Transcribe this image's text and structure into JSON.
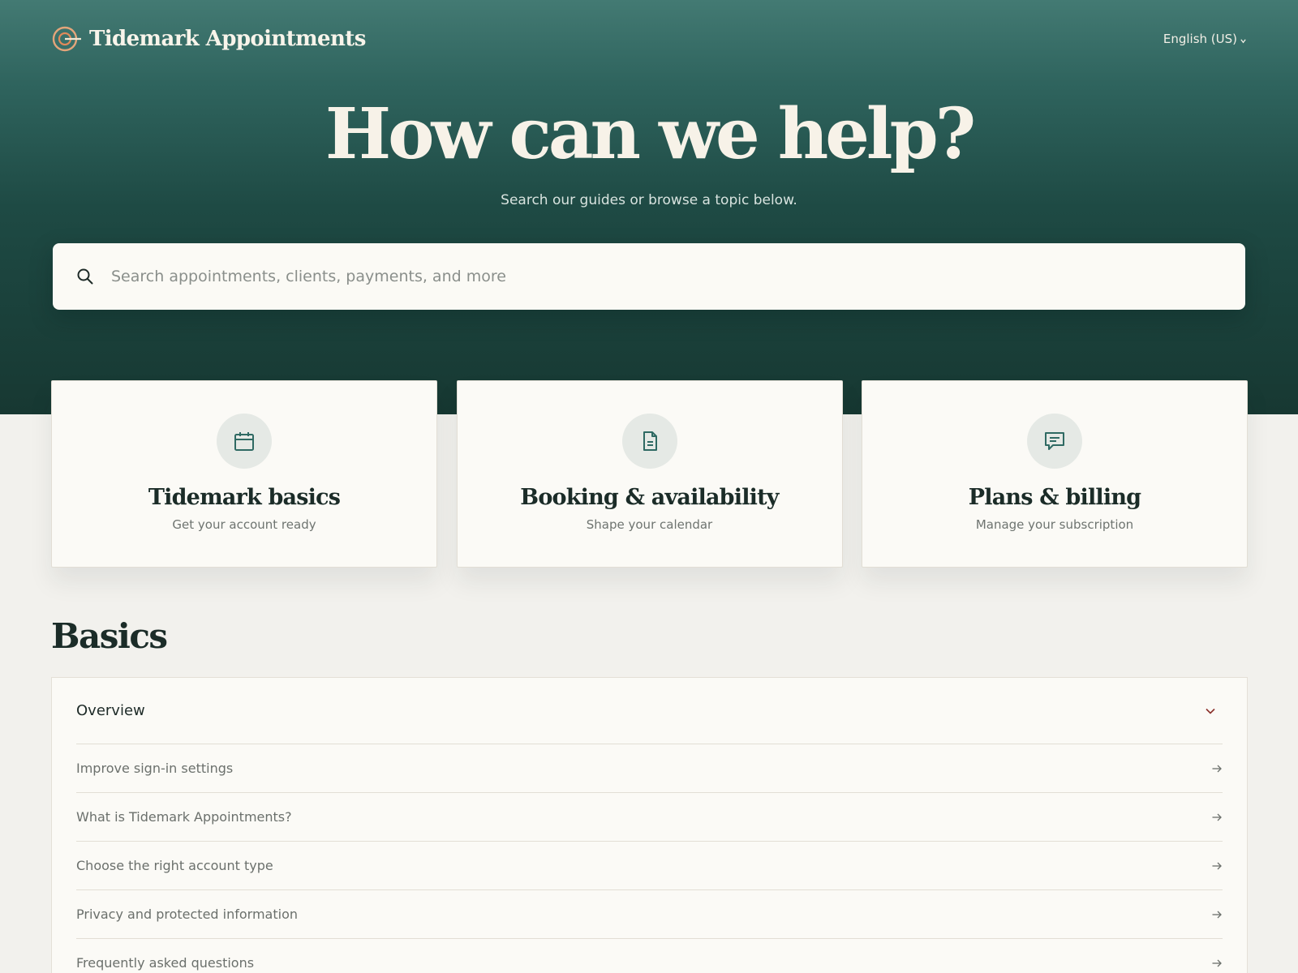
{
  "header": {
    "brand_name": "Tidemark Appointments",
    "language": "English (US)"
  },
  "hero": {
    "title": "How can we help?",
    "subtitle": "Search our guides or browse a topic below."
  },
  "search": {
    "placeholder": "Search appointments, clients, payments, and more",
    "value": ""
  },
  "topics": [
    {
      "title": "Tidemark basics",
      "description": "Get your account ready",
      "icon": "calendar-icon"
    },
    {
      "title": "Booking & availability",
      "description": "Shape your calendar",
      "icon": "document-icon"
    },
    {
      "title": "Plans & billing",
      "description": "Manage your subscription",
      "icon": "chat-icon"
    }
  ],
  "section": {
    "title": "Basics",
    "group_label": "Overview",
    "articles": [
      "Improve sign-in settings",
      "What is Tidemark Appointments?",
      "Choose the right account type",
      "Privacy and protected information",
      "Frequently asked questions"
    ]
  },
  "colors": {
    "hero_top": "#437a73",
    "hero_bottom": "#173832",
    "accent_orange": "#e08a5a",
    "icon_teal": "#2f6a63",
    "chevron_red": "#8a2f2a"
  }
}
